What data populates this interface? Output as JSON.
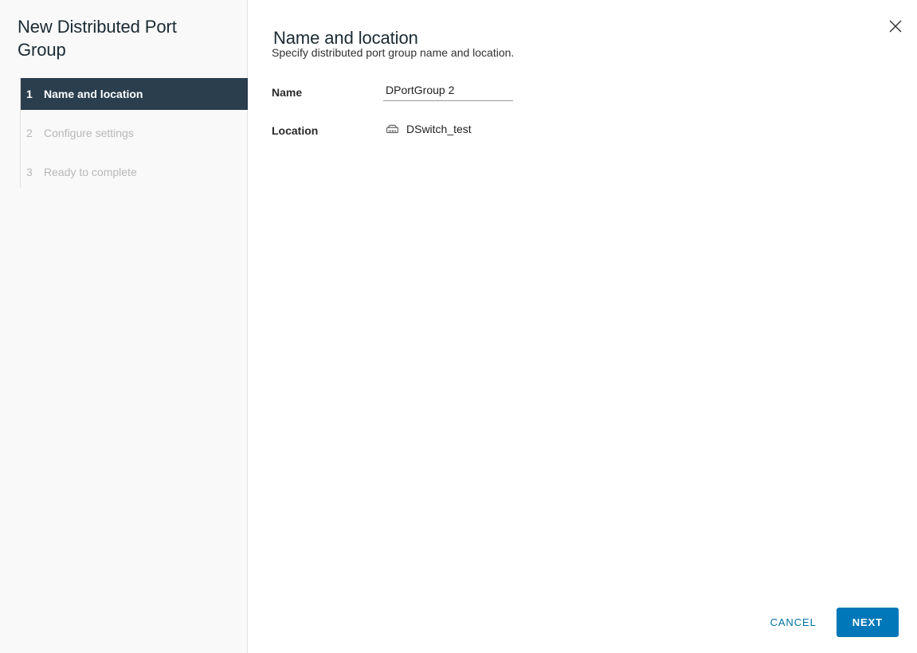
{
  "wizard": {
    "title": "New Distributed Port Group",
    "close_icon": "close-icon"
  },
  "sidebar": {
    "steps": [
      {
        "number": "1",
        "label": "Name and location",
        "state": "active"
      },
      {
        "number": "2",
        "label": "Configure settings",
        "state": "inactive"
      },
      {
        "number": "3",
        "label": "Ready to complete",
        "state": "inactive"
      }
    ]
  },
  "main": {
    "heading": "Name and location",
    "subheading": "Specify distributed port group name and location.",
    "form": {
      "name": {
        "label": "Name",
        "value": "DPortGroup 2",
        "placeholder": ""
      },
      "location": {
        "label": "Location",
        "icon": "distributed-switch-icon",
        "value": "DSwitch_test"
      }
    }
  },
  "footer": {
    "cancel_label": "CANCEL",
    "next_label": "NEXT"
  },
  "colors": {
    "accent": "#0077b8",
    "link": "#0072a3",
    "active_step_bg": "#2b3e4d",
    "sidebar_bg": "#f9f9f9",
    "muted_text": "#b8b8b8"
  }
}
